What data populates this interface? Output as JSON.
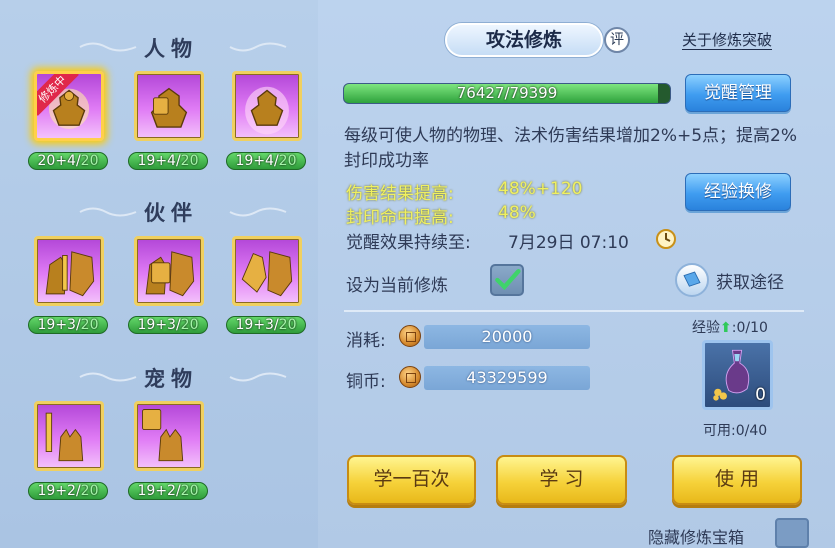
{
  "left": {
    "sections": [
      {
        "title": "人物"
      },
      {
        "title": "伙伴"
      },
      {
        "title": "宠物"
      }
    ],
    "training_tag": "修炼中",
    "levels": [
      {
        "main": "20+4/",
        "max": "20"
      },
      {
        "main": "19+4/",
        "max": "20"
      },
      {
        "main": "19+4/",
        "max": "20"
      },
      {
        "main": "19+3/",
        "max": "20"
      },
      {
        "main": "19+3/",
        "max": "20"
      },
      {
        "main": "19+3/",
        "max": "20"
      },
      {
        "main": "19+2/",
        "max": "20"
      },
      {
        "main": "19+2/",
        "max": "20"
      }
    ]
  },
  "right": {
    "title": "攻法修炼",
    "rate_icon": "评",
    "about_link": "关于修炼突破",
    "progress": {
      "current": 76427,
      "max": 79399,
      "text": "76427/79399"
    },
    "awaken_button": "觉醒管理",
    "description": "每级可使人物的物理、法术伤害结果增加2%+5点；提高2%封印成功率",
    "exchange_button": "经验换修",
    "stats": {
      "damage_label": "伤害结果提高:",
      "damage_value": "48%+120",
      "seal_label": "封印命中提高:",
      "seal_value": "48%",
      "duration_label": "觉醒效果持续至:",
      "duration_value": "7月29日 07:10"
    },
    "set_current_label": "设为当前修炼",
    "set_current_checked": true,
    "get_source": "获取途径",
    "cost_label": "消耗:",
    "cost_value": "20000",
    "coins_label": "铜币:",
    "coins_value": "43329599",
    "exp_label": "经验",
    "exp_value": ":0/10",
    "item_count": "0",
    "available": "可用:0/40",
    "buttons": {
      "learn100": "学一百次",
      "learn": "学 习",
      "use": "使 用"
    },
    "hide_chest": "隐藏修炼宝箱"
  }
}
